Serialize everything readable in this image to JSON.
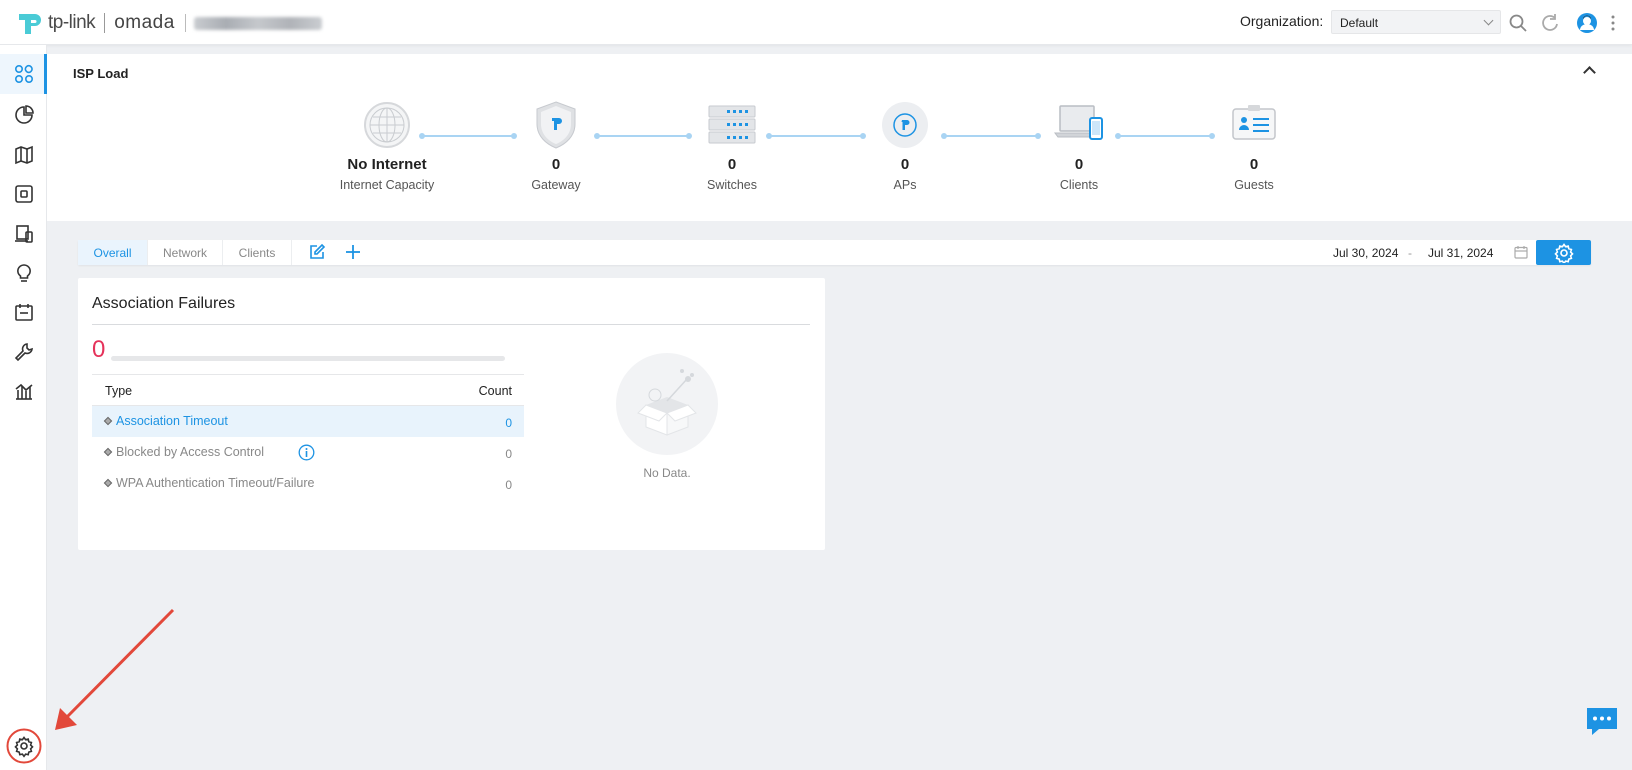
{
  "header": {
    "brand_tplink": "tp-link",
    "brand_omada": "omada",
    "org_label": "Organization:",
    "org_value": "Default",
    "accent": "#1d93e3"
  },
  "sidebar": {
    "items": [
      {
        "name": "dashboard",
        "icon": "dashboard-grid-icon",
        "active": true
      },
      {
        "name": "statistics",
        "icon": "pie-chart-icon"
      },
      {
        "name": "map",
        "icon": "map-icon"
      },
      {
        "name": "devices",
        "icon": "device-box-icon"
      },
      {
        "name": "clients",
        "icon": "client-devices-icon"
      },
      {
        "name": "insight",
        "icon": "lightbulb-icon"
      },
      {
        "name": "logs",
        "icon": "log-calendar-icon"
      },
      {
        "name": "tools",
        "icon": "wrench-icon"
      },
      {
        "name": "reports",
        "icon": "report-chart-icon"
      }
    ],
    "bottom_icon": "gear-icon"
  },
  "isp": {
    "title": "ISP Load",
    "nodes": [
      {
        "value": "No Internet",
        "label": "Internet Capacity"
      },
      {
        "value": "0",
        "label": "Gateway"
      },
      {
        "value": "0",
        "label": "Switches"
      },
      {
        "value": "0",
        "label": "APs"
      },
      {
        "value": "0",
        "label": "Clients"
      },
      {
        "value": "0",
        "label": "Guests"
      }
    ]
  },
  "tabs": {
    "items": [
      "Overall",
      "Network",
      "Clients"
    ],
    "active": "Overall",
    "date_start": "Jul 30, 2024",
    "date_sep": "-",
    "date_end": "Jul 31, 2024"
  },
  "card": {
    "title": "Association Failures",
    "total": "0",
    "col_type": "Type",
    "col_count": "Count",
    "rows": [
      {
        "type": "Association Timeout",
        "count": "0",
        "selected": true
      },
      {
        "type": "Blocked by Access Control",
        "count": "0",
        "info": true
      },
      {
        "type": "WPA Authentication Timeout/Failure",
        "count": "0"
      }
    ],
    "empty_text": "No Data."
  }
}
